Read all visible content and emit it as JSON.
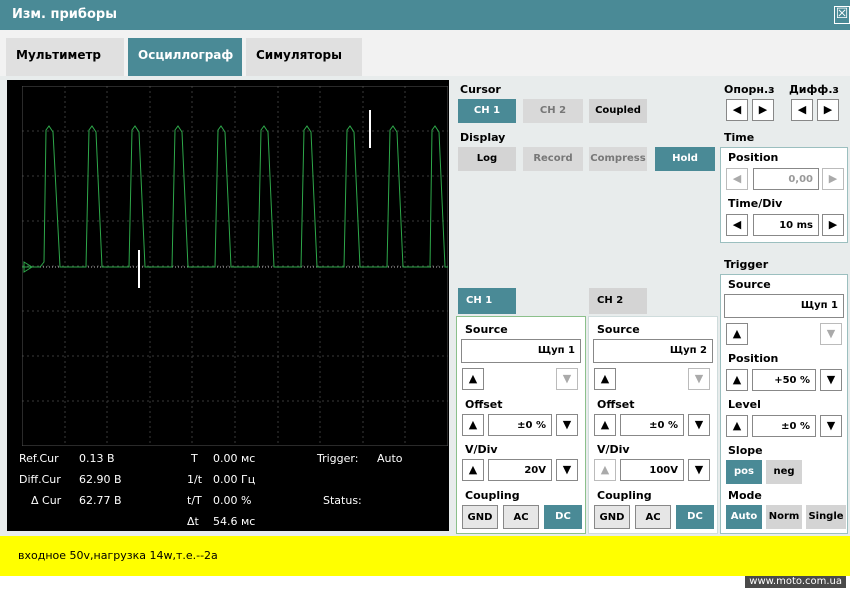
{
  "window": {
    "title": "Изм. приборы",
    "close": "☒"
  },
  "tabs": [
    "Мультиметр",
    "Осциллограф",
    "Симуляторы"
  ],
  "readouts": {
    "ref_cur_label": "Ref.Cur",
    "ref_cur_value": "0.13 В",
    "diff_cur_label": "Diff.Cur",
    "diff_cur_value": "62.90 В",
    "delta_cur_label": "Δ Cur",
    "delta_cur_value": "62.77 В",
    "t_label": "T",
    "t_value": "0.00 мс",
    "inv_t_label": "1/t",
    "inv_t_value": "0.00 Гц",
    "t_over_T_label": "t/T",
    "t_over_T_value": "0.00 %",
    "dt_label": "Δt",
    "dt_value": "54.6 мс",
    "trigger_label": "Trigger:",
    "trigger_value": "Auto",
    "status_label": "Status:"
  },
  "cursor": {
    "title": "Cursor",
    "ch1": "CH 1",
    "ch2": "CH 2",
    "coupled": "Coupled"
  },
  "display": {
    "title": "Display",
    "log": "Log",
    "record": "Record",
    "compress": "Compress",
    "hold": "Hold"
  },
  "reference": {
    "ref_label": "Опорн.з",
    "diff_label": "Дифф.з"
  },
  "time": {
    "title": "Time",
    "position_label": "Position",
    "position_value": "0,00",
    "timediv_label": "Time/Div",
    "timediv_value": "10 ms"
  },
  "trigger": {
    "title": "Trigger",
    "source_label": "Source",
    "source_value": "Щуп 1",
    "position_label": "Position",
    "position_value": "+50 %",
    "level_label": "Level",
    "level_value": "±0 %",
    "slope_label": "Slope",
    "slope_pos": "pos",
    "slope_neg": "neg",
    "mode_label": "Mode",
    "mode_auto": "Auto",
    "mode_norm": "Norm",
    "mode_single": "Single"
  },
  "ch1": {
    "tab": "CH 1",
    "source_label": "Source",
    "source_value": "Щуп 1",
    "offset_label": "Offset",
    "offset_value": "±0 %",
    "vdiv_label": "V/Div",
    "vdiv_value": "20V",
    "coupling_label": "Coupling",
    "gnd": "GND",
    "ac": "AC",
    "dc": "DC"
  },
  "ch2": {
    "tab": "CH 2",
    "source_label": "Source",
    "source_value": "Щуп 2",
    "offset_label": "Offset",
    "offset_value": "±0 %",
    "vdiv_label": "V/Div",
    "vdiv_value": "100V",
    "coupling_label": "Coupling",
    "gnd": "GND",
    "ac": "AC",
    "dc": "DC"
  },
  "footer": {
    "note": "входное 50v,нагрузка 14w,т.е.--2а",
    "watermark": "www.moto.com.ua"
  },
  "colors": {
    "accent": "#4a8a96",
    "trace": "#2ea84a",
    "footer": "#ffff00"
  }
}
